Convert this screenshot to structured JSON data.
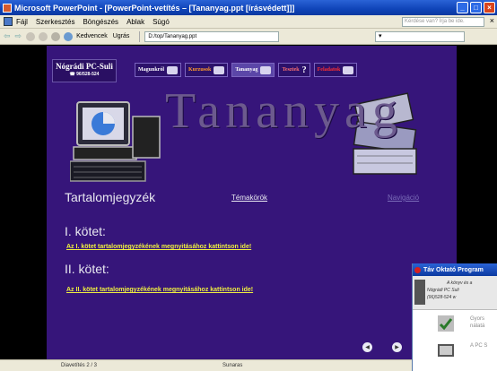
{
  "window": {
    "title": "Microsoft PowerPoint - [PowerPoint-vetítés – [Tananyag.ppt [írásvédett]]]"
  },
  "menubar": {
    "items": [
      "Fájl",
      "Szerkesztés",
      "Böngészés",
      "Ablak",
      "Súgó"
    ],
    "help_placeholder": "Kérdése van? Írja be ide."
  },
  "toolbar": {
    "favorites": "Kedvencek",
    "goto": "Ugrás",
    "address": "D:/top/Tananyag.ppt"
  },
  "slide": {
    "logo_title": "Nógrádi PC-Suli",
    "logo_phone": "☎ 96/528-524",
    "nav": [
      {
        "label": "Magunkról",
        "color": "#ffffff"
      },
      {
        "label": "Kurzusok",
        "color": "#ff9a2a"
      },
      {
        "label": "Tananyag",
        "color": "#ffffff"
      },
      {
        "label": "Tesztek",
        "color": "#ff7070"
      },
      {
        "label": "Feladatok",
        "color": "#ff3030"
      }
    ],
    "big_title": "Tananyag",
    "toc_title": "Tartalomjegyzék",
    "topics_link": "Témakörök",
    "navigation_link": "Navigáció",
    "volume1_title": "I. kötet:",
    "volume1_link": "Az I. kötet tartalomjegyzékének megnyitásához kattintson ide!",
    "volume2_title": "II. kötet:",
    "volume2_link": "Az II. kötet tartalomjegyzékének megnyitásához kattintson ide!"
  },
  "status": {
    "slide_count": "Diavetítés 2 / 3",
    "theme": "Sunaras"
  },
  "popup": {
    "title": "Táv Oktató Program",
    "header_line1": "A könyv és a",
    "header_line2": "Nógrádi PC  Suli",
    "header_line3": "(96)528-524  w",
    "item1_line1": "Gyors",
    "item1_line2": "nálatá",
    "item2_line1": "A PC S"
  }
}
